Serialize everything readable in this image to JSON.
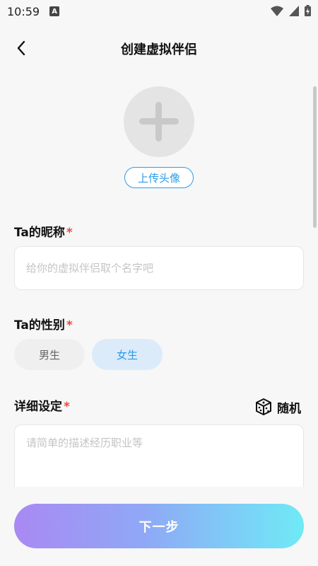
{
  "status_bar": {
    "time": "10:59",
    "notification_letter": "A",
    "icons": [
      "wifi-icon",
      "signal-icon",
      "battery-charging-icon"
    ]
  },
  "header": {
    "back_icon": "chevron-left-icon",
    "title": "创建虚拟伴侣"
  },
  "avatar": {
    "icon": "plus-icon",
    "upload_label": "上传头像"
  },
  "nickname": {
    "label": "Ta的昵称",
    "required_mark": "*",
    "value": "",
    "placeholder": "给你的虚拟伴侣取个名字吧"
  },
  "gender": {
    "label": "Ta的性别",
    "required_mark": "*",
    "options": [
      "男生",
      "女生"
    ],
    "selected": "女生"
  },
  "details": {
    "label": "详细设定",
    "required_mark": "*",
    "random_icon": "dice-icon",
    "random_label": "随机",
    "value": "",
    "placeholder": "请简单的描述经历职业等"
  },
  "footer": {
    "next_label": "下一步"
  },
  "colors": {
    "accent_blue": "#2b9be8",
    "required_red": "#f04545",
    "gradient_start": "#a989f2",
    "gradient_end": "#6feaf6"
  }
}
